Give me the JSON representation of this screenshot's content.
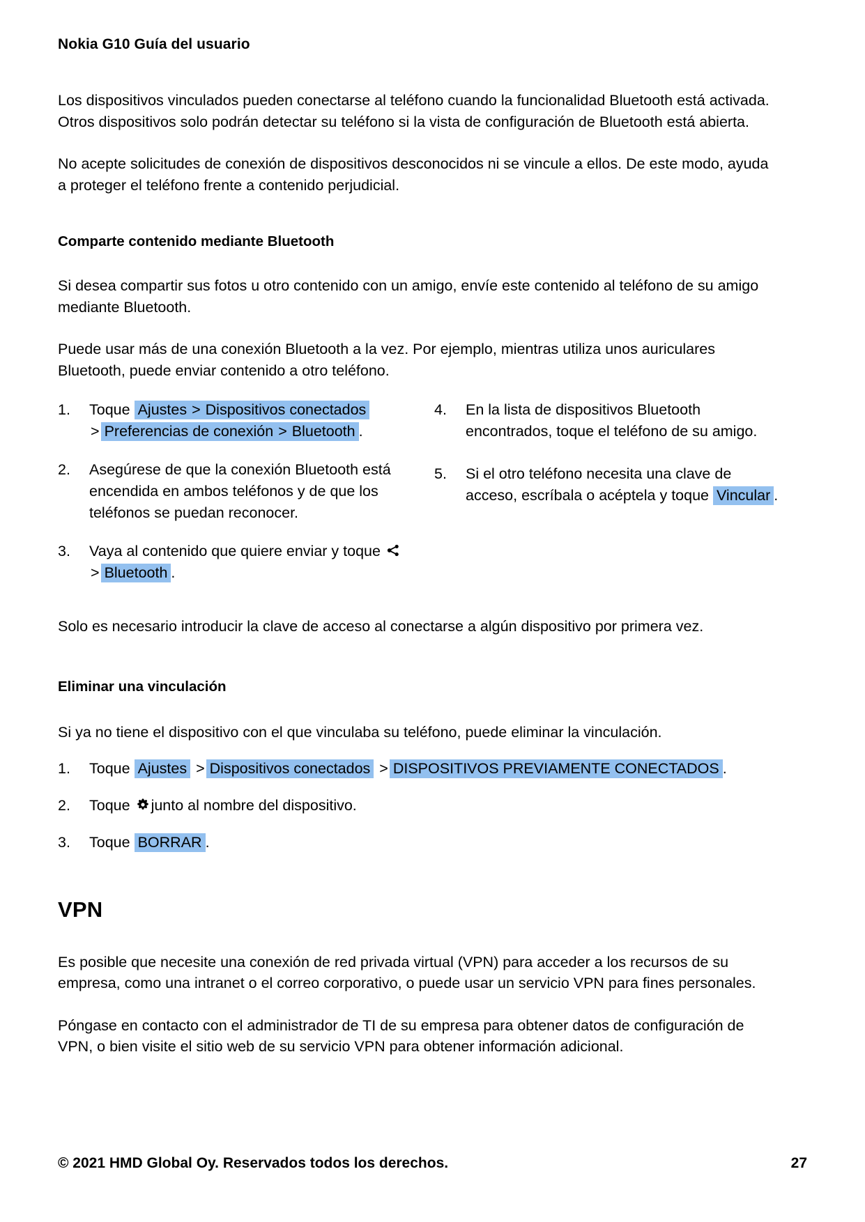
{
  "header": {
    "running_title": "Nokia G10 Guía del usuario"
  },
  "body": {
    "intro_paragraph_1": "Los dispositivos vinculados pueden conectarse al teléfono cuando la funcionalidad Bluetooth está activada. Otros dispositivos solo podrán detectar su teléfono si la vista de configuración de Bluetooth está abierta.",
    "intro_paragraph_2": "No acepte solicitudes de conexión de dispositivos desconocidos ni se vincule a ellos. De este modo, ayuda a proteger el teléfono frente a contenido perjudicial."
  },
  "share_section": {
    "heading": "Comparte contenido mediante Bluetooth",
    "paragraph_1": "Si desea compartir sus fotos u otro contenido con un amigo, envíe este contenido al teléfono de su amigo mediante Bluetooth.",
    "paragraph_2": "Puede usar más de una conexión Bluetooth a la vez. Por ejemplo, mientras utiliza unos auriculares Bluetooth, puede enviar contenido a otro teléfono.",
    "steps": {
      "step1": {
        "number": "1.",
        "text_before": "Toque",
        "ui_1": "Ajustes",
        "sep_1": ">",
        "ui_2": "Dispositivos conectados",
        "sep_2": ">",
        "ui_3": "Preferencias de conexión",
        "sep_3": ">",
        "ui_4": "Bluetooth",
        "text_after": "."
      },
      "step2": {
        "number": "2.",
        "text": "Asegúrese de que la conexión Bluetooth está encendida en ambos teléfonos y de que los teléfonos se puedan reconocer."
      },
      "step3": {
        "number": "3.",
        "text_before": "Vaya al contenido que quiere enviar y toque",
        "icon": "share-icon",
        "sep_1": ">",
        "ui_1": "Bluetooth",
        "text_after": "."
      },
      "step4": {
        "number": "4.",
        "text": "En la lista de dispositivos Bluetooth encontrados, toque el teléfono de su amigo."
      },
      "step5": {
        "number": "5.",
        "text_before": "Si el otro teléfono necesita una clave de acceso, escríbala o acéptela y toque",
        "ui_1": "Vincular",
        "text_after": "."
      }
    },
    "note": "Solo es necesario introducir la clave de acceso al conectarse a algún dispositivo por primera vez."
  },
  "unpair_section": {
    "heading": "Eliminar una vinculación",
    "paragraph": "Si ya no tiene el dispositivo con el que vinculaba su teléfono, puede eliminar la vinculación.",
    "steps": {
      "step1": {
        "number": "1.",
        "text_before": "Toque",
        "ui_1": "Ajustes",
        "sep_1": ">",
        "ui_2": "Dispositivos conectados",
        "sep_2": ">",
        "ui_3": "DISPOSITIVOS PREVIAMENTE CONECTADOS",
        "text_after": "."
      },
      "step2": {
        "number": "2.",
        "text_before": "Toque",
        "icon": "gear-icon",
        "text_after": "junto al nombre del dispositivo."
      },
      "step3": {
        "number": "3.",
        "text_before": "Toque",
        "ui_1": "BORRAR",
        "text_after": "."
      }
    }
  },
  "vpn_section": {
    "heading": "VPN",
    "paragraph_1": "Es posible que necesite una conexión de red privada virtual (VPN) para acceder a los recursos de su empresa, como una intranet o el correo corporativo, o puede usar un servicio VPN para fines personales.",
    "paragraph_2": "Póngase en contacto con el administrador de TI de su empresa para obtener datos de configuración de VPN, o bien visite el sitio web de su servicio VPN para obtener información adicional."
  },
  "footer": {
    "copyright": "© 2021 HMD Global Oy. Reservados todos los derechos.",
    "page_number": "27"
  },
  "colors": {
    "ui_highlight": "#93c0ef",
    "text": "#000000",
    "page_background": "#ffffff"
  }
}
